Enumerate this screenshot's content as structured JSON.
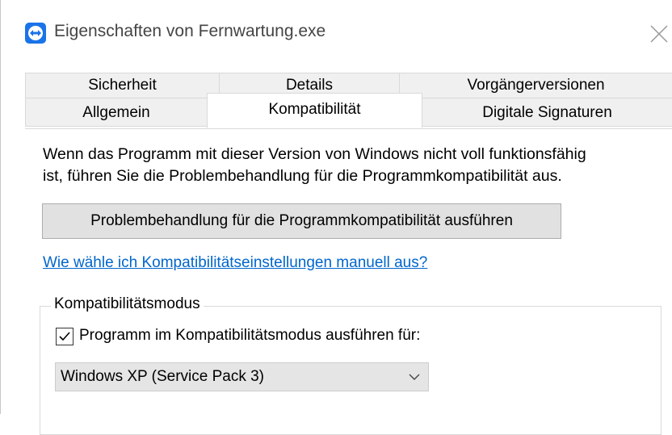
{
  "window": {
    "title": "Eigenschaften von Fernwartung.exe",
    "icon": "teamviewer-app-icon",
    "accent_color": "#1a73e8"
  },
  "tabs": {
    "row1": [
      {
        "label": "Sicherheit"
      },
      {
        "label": "Details"
      },
      {
        "label": "Vorgängerversionen"
      }
    ],
    "row2": [
      {
        "label": "Allgemein"
      },
      {
        "label": "Kompatibilität",
        "active": true
      },
      {
        "label": "Digitale Signaturen"
      }
    ]
  },
  "content": {
    "description_line1": "Wenn das Programm mit dieser Version von Windows nicht voll funktionsfähig",
    "description_line2": "ist, führen Sie die Problembehandlung für die Programmkompatibilität aus.",
    "troubleshooter_button": "Problembehandlung für die Programmkompatibilität ausführen",
    "help_link": "Wie wähle ich Kompatibilitätseinstellungen manuell aus?",
    "link_color": "#0066cc",
    "compat_group": {
      "legend": "Kompatibilitätsmodus",
      "checkbox_label": "Programm im Kompatibilitätsmodus ausführen für:",
      "checkbox_checked": true,
      "selected_os": "Windows XP (Service Pack 3)"
    }
  }
}
